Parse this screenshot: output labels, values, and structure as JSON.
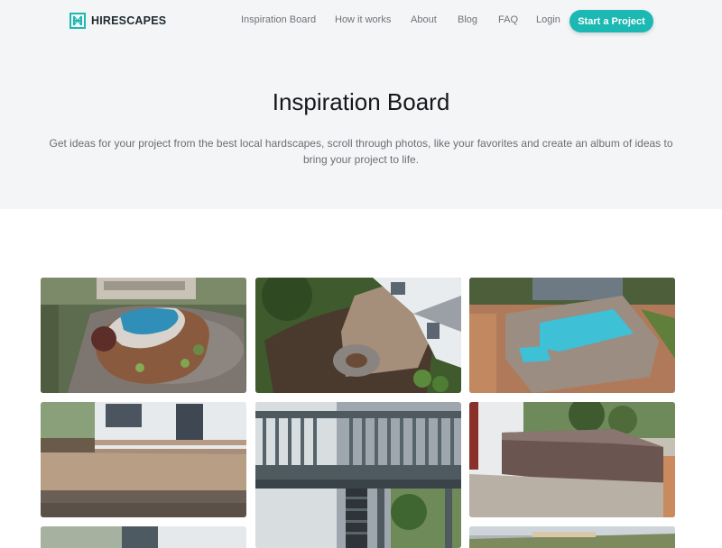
{
  "brand": {
    "name": "HIRESCAPES",
    "accent": "#1cb8b3"
  },
  "nav": {
    "links": [
      "Inspiration Board",
      "How it works",
      "About",
      "Blog",
      "FAQ",
      "Login"
    ],
    "cta": "Start a Project"
  },
  "hero": {
    "title": "Inspiration Board",
    "subtitle": "Get ideas for your project from the best local hardscapes, scroll through photos, like your favorites and create an album of ideas to bring your project to life."
  },
  "gallery": {
    "photos": [
      {
        "subject": "aerial view of kidney-shaped pool with landscaped patio"
      },
      {
        "subject": "aerial view of paver walkway and circular fire pit patio"
      },
      {
        "subject": "aerial view of rectangular pool with paver deck"
      },
      {
        "subject": "paver patio behind house"
      },
      {
        "subject": "elevated wooden deck with staircase"
      },
      {
        "subject": "stone retaining wall beside house"
      },
      {
        "subject": "house exterior with trees"
      },
      {
        "subject": "front yard hardscape by driveway"
      }
    ]
  }
}
